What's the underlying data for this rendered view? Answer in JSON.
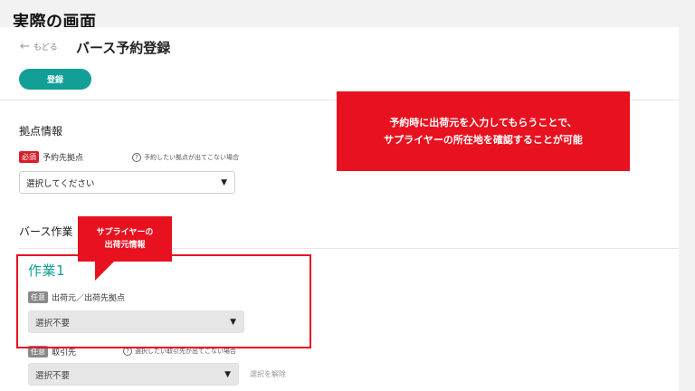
{
  "slide": {
    "title": "実際の画面"
  },
  "header": {
    "back_label": "もどる",
    "title": "バース予約登録",
    "register_label": "登録"
  },
  "base_section": {
    "title": "拠点情報",
    "field_badge": "必須",
    "field_label": "予約先拠点",
    "help_text": "予約したい拠点が出てこない場合",
    "select_value": "選択してください"
  },
  "work_section": {
    "title": "バース作業",
    "task_title": "作業1",
    "origin": {
      "badge": "任意",
      "label": "出荷元／出荷先拠点",
      "select_value": "選択不要"
    },
    "partner": {
      "badge": "任意",
      "label": "取引先",
      "help_text": "選択したい取引先が出てこない場合",
      "select_value": "選択不要",
      "clear_label": "選択を解除"
    }
  },
  "annotations": {
    "callout_line1": "予約時に出荷元を入力してもらうことで、",
    "callout_line2": "サプライヤーの所在地を確認することが可能",
    "bubble_line1": "サプライヤーの",
    "bubble_line2": "出荷元情報",
    "accent_color": "#e8111f"
  },
  "colors": {
    "primary": "#129f95",
    "required": "#d61f2c"
  }
}
